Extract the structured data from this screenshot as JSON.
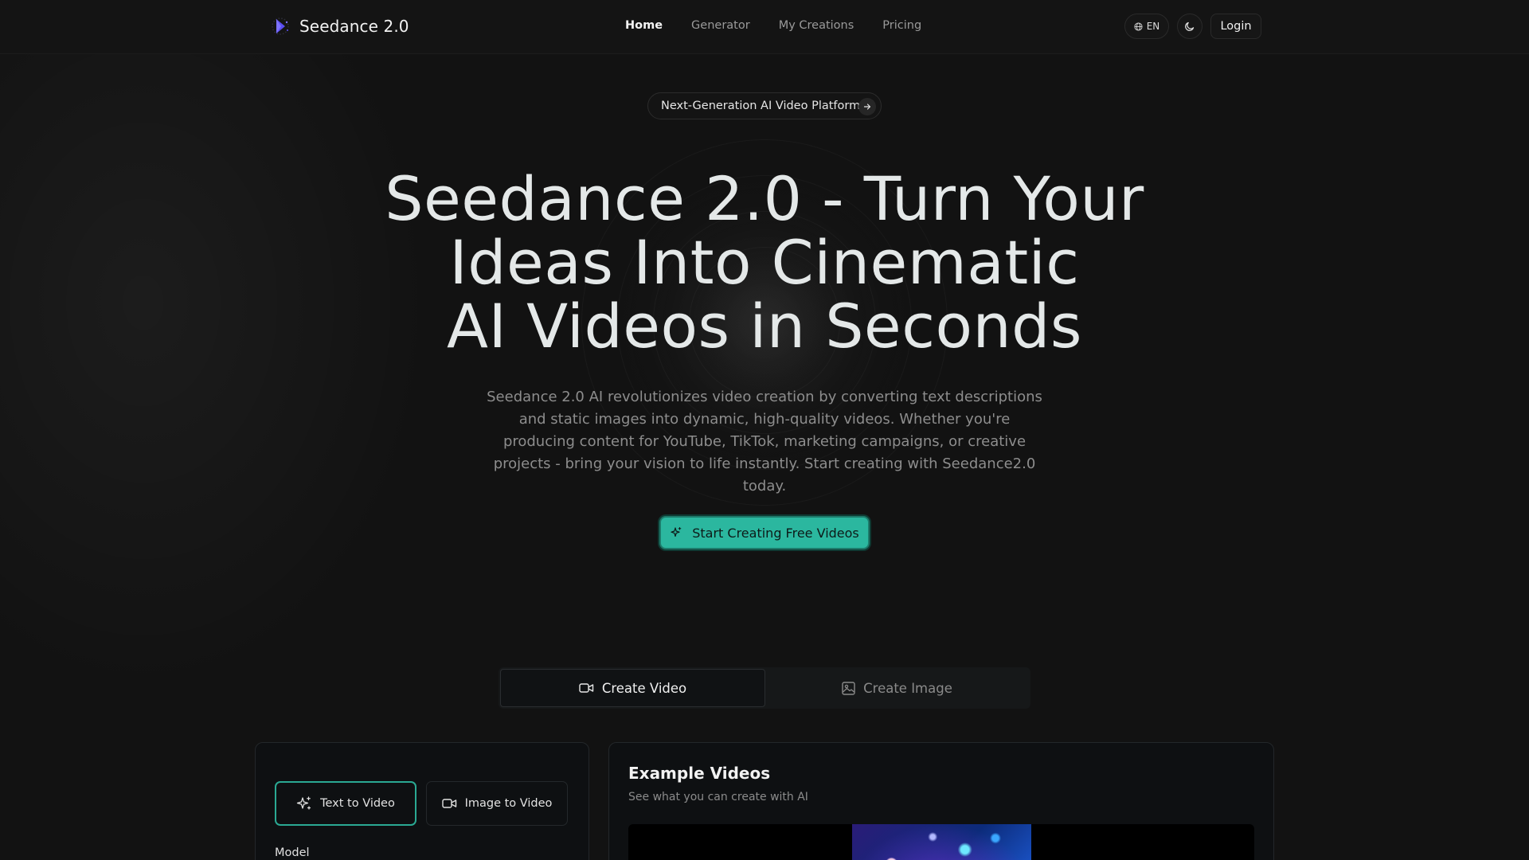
{
  "header": {
    "brand_name": "Seedance 2.0",
    "nav": [
      {
        "label": "Home",
        "active": true
      },
      {
        "label": "Generator",
        "active": false
      },
      {
        "label": "My Creations",
        "active": false
      },
      {
        "label": "Pricing",
        "active": false
      }
    ],
    "language": "EN",
    "login_label": "Login"
  },
  "hero": {
    "badge": "Next-Generation AI Video Platform",
    "title_lines": [
      "Seedance 2.0 - Turn Your",
      "Ideas Into Cinematic",
      "AI Videos in Seconds"
    ],
    "subtitle": "Seedance 2.0 AI revolutionizes video creation by converting text descriptions and static images into dynamic, high-quality videos. Whether you're producing content for YouTube, TikTok, marketing campaigns, or creative projects - bring your vision to life instantly. Start creating with Seedance2.0 today.",
    "cta_label": "Start Creating Free Videos"
  },
  "mode_tabs": [
    {
      "label": "Create Video",
      "active": true
    },
    {
      "label": "Create Image",
      "active": false
    }
  ],
  "generator": {
    "sub_tabs": [
      {
        "label": "Text to Video",
        "active": true
      },
      {
        "label": "Image to Video",
        "active": false
      }
    ],
    "model_label": "Model"
  },
  "examples": {
    "title": "Example Videos",
    "subtitle": "See what you can create with AI"
  },
  "colors": {
    "accent": "#2bb79f",
    "background": "#121212",
    "logo": "#5b4ef0"
  }
}
